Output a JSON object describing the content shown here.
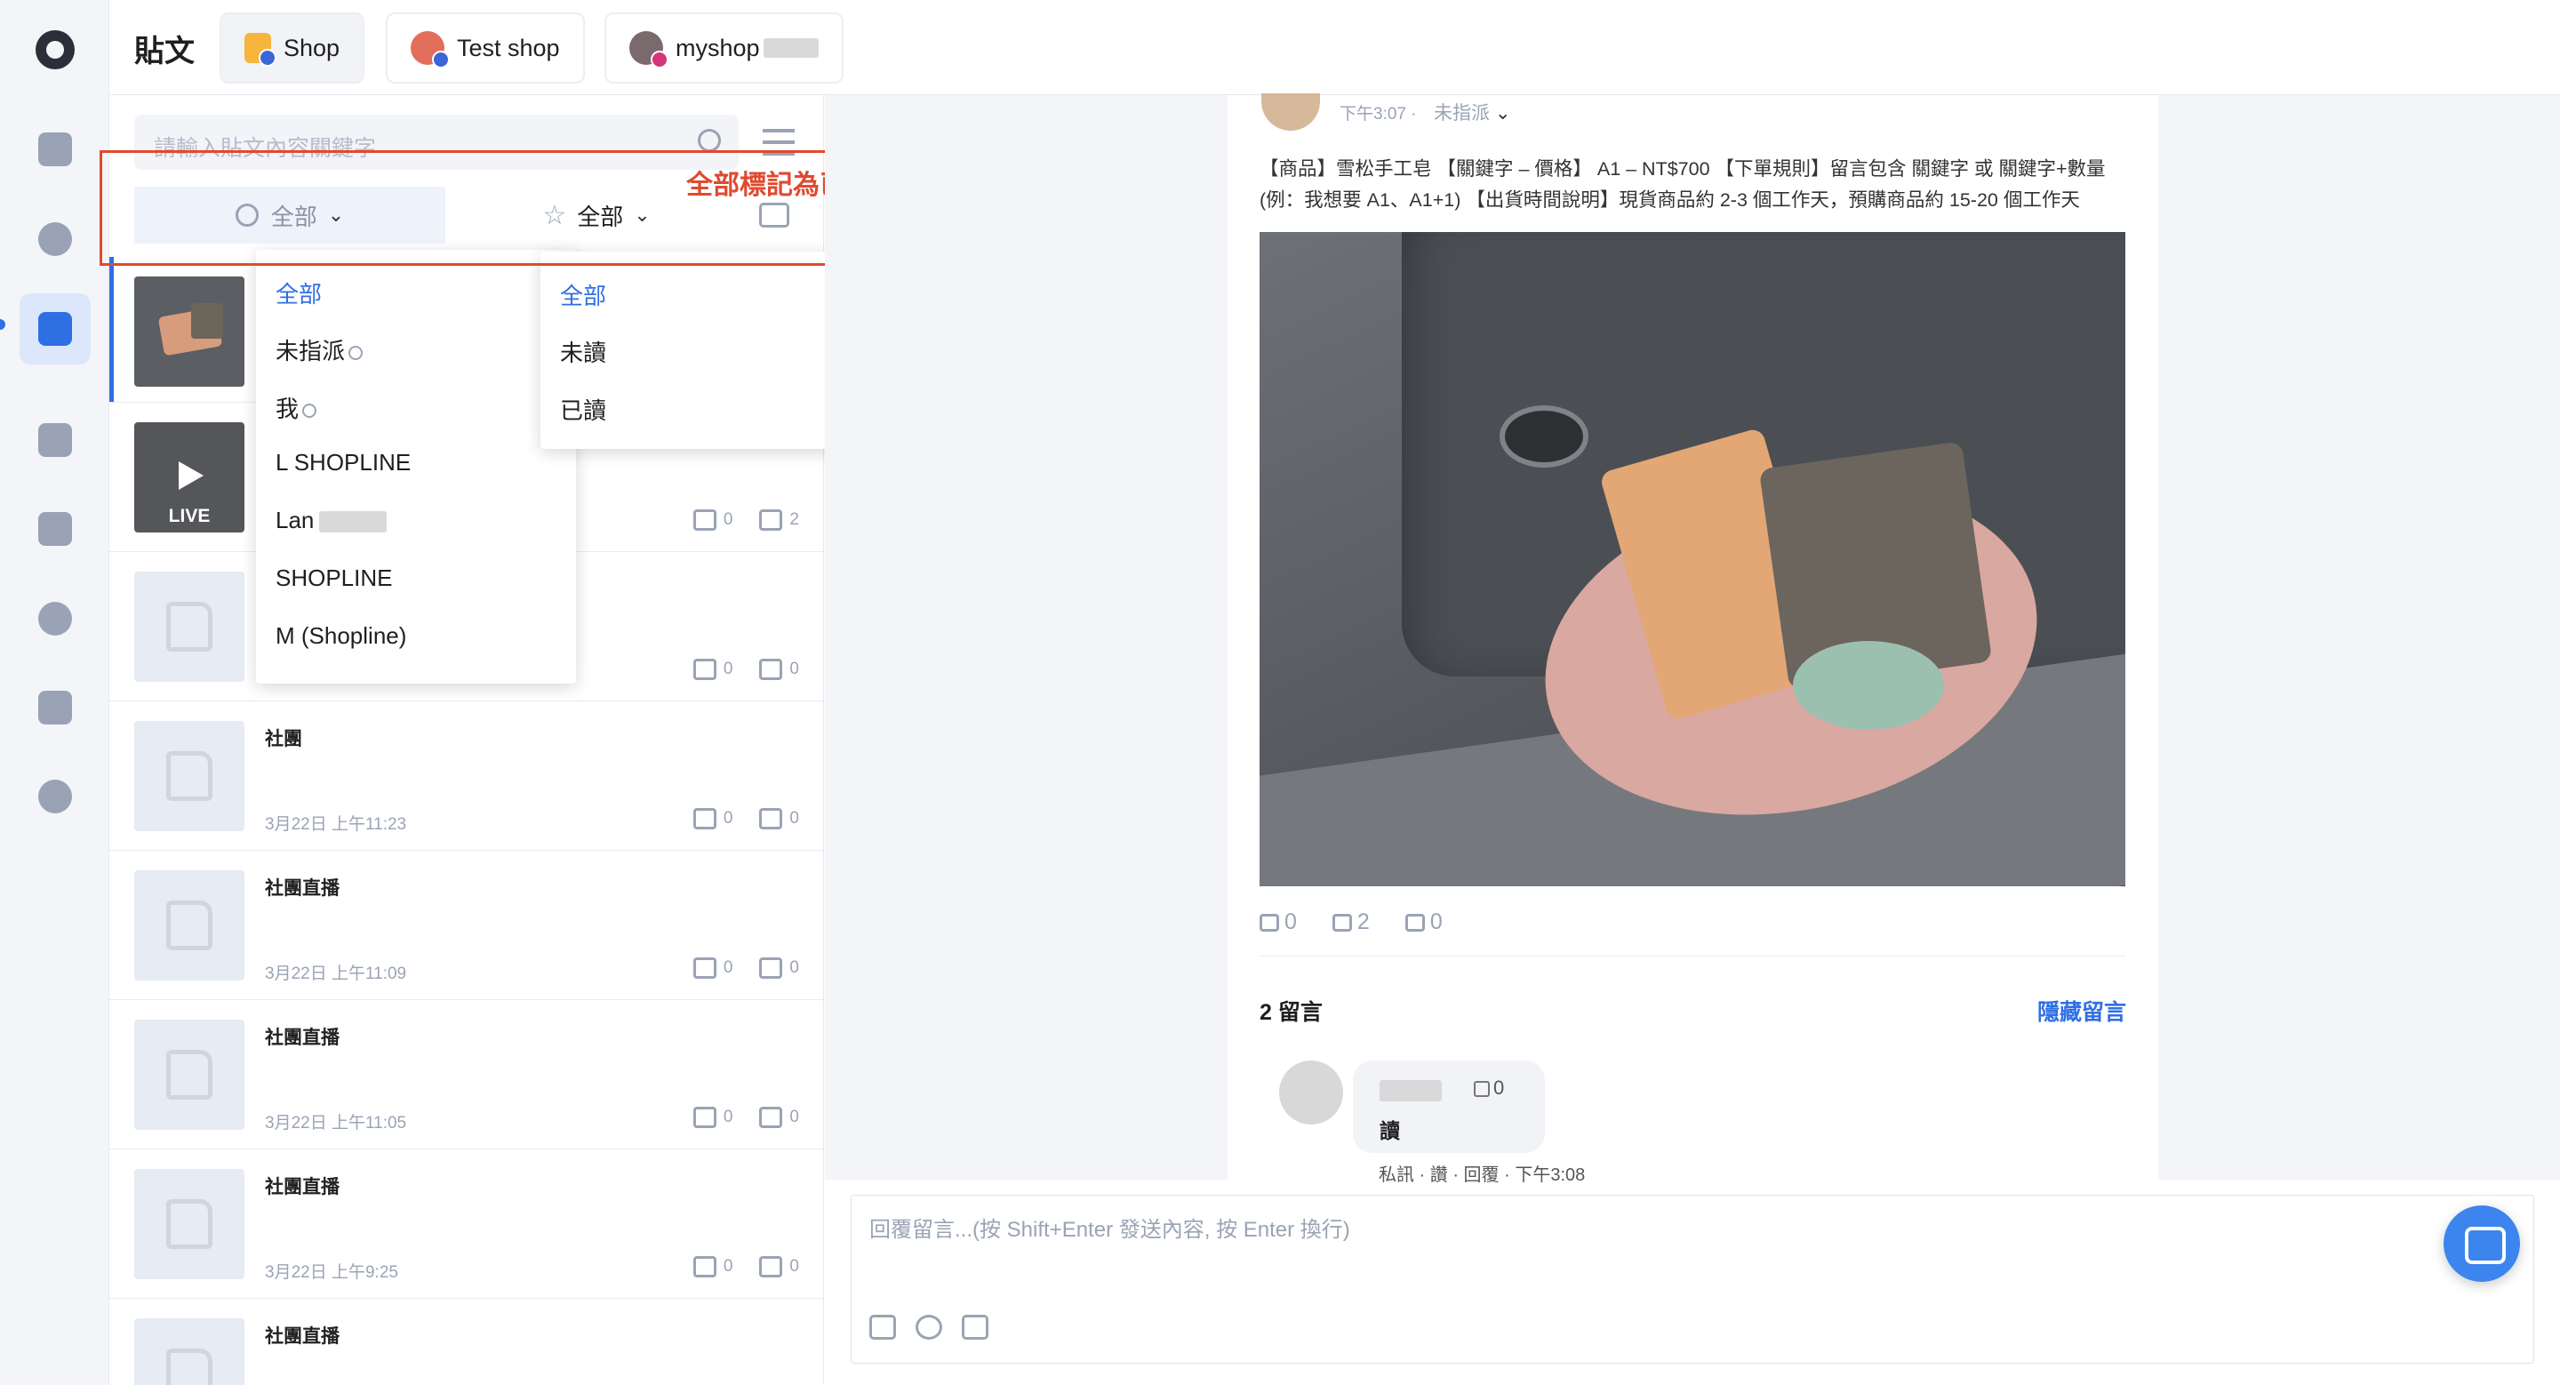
{
  "header": {
    "title": "貼文",
    "tabs": [
      {
        "label": "Shop",
        "active": true
      },
      {
        "label": "Test shop",
        "active": false
      },
      {
        "label": "myshop",
        "active": false
      }
    ]
  },
  "sidebar": {
    "items": [
      "mail-icon",
      "chat-icon",
      "posts-icon",
      "broadcast-icon",
      "bot-icon",
      "contacts-icon",
      "tags-icon",
      "more-icon"
    ],
    "active": "posts-icon"
  },
  "search": {
    "placeholder": "請輸入貼文內容關鍵字"
  },
  "filters": {
    "assignee_label": "全部",
    "read_label": "全部"
  },
  "assignee_dropdown": [
    "全部",
    "未指派",
    "我",
    "L SHOPLINE",
    "Lan",
    "SHOPLINE",
    "M (Shopline)"
  ],
  "read_dropdown": [
    "全部",
    "未讀",
    "已讀"
  ],
  "annotation": "全部標記為已讀",
  "posts": [
    {
      "title": "",
      "date": "",
      "likes": "",
      "comments": ""
    },
    {
      "title": "",
      "date": "",
      "likes": "0",
      "comments": "2",
      "live_label": "LIVE"
    },
    {
      "title": "",
      "date": "",
      "likes": "0",
      "comments": "0"
    },
    {
      "title": "社團",
      "date": "3月22日 上午11:23",
      "likes": "0",
      "comments": "0"
    },
    {
      "title": "社團直播",
      "date": "3月22日 上午11:09",
      "likes": "0",
      "comments": "0"
    },
    {
      "title": "社團直播",
      "date": "3月22日 上午11:05",
      "likes": "0",
      "comments": "0"
    },
    {
      "title": "社團直播",
      "date": "3月22日 上午9:25",
      "likes": "0",
      "comments": "0"
    },
    {
      "title": "社團直播",
      "date": "",
      "likes": "",
      "comments": ""
    }
  ],
  "detail": {
    "time": "下午3:07 ·",
    "assign": "未指派",
    "description": "【商品】雪松手工皂 【關鍵字 – 價格】 A1 – NT$700 【下單規則】留言包含 關鍵字 或 關鍵字+數量 (例：我想要 A1、A1+1) 【出貨時間說明】現貨商品約 2-3 個工作天，預購商品約 15-20 個工作天",
    "reactions": {
      "likes": "0",
      "comments": "2",
      "shares": "0"
    },
    "comment_count": "2 留言",
    "hide_comments": "隱藏留言",
    "comment": {
      "likes": "0",
      "text": "讀",
      "meta": "私訊 · 讚 · 回覆 · 下午3:08"
    }
  },
  "reply": {
    "placeholder": "回覆留言...(按 Shift+Enter 發送內容, 按 Enter 換行)"
  },
  "colors": {
    "accent": "#2f6fe4",
    "annotation": "#e04a2f"
  }
}
